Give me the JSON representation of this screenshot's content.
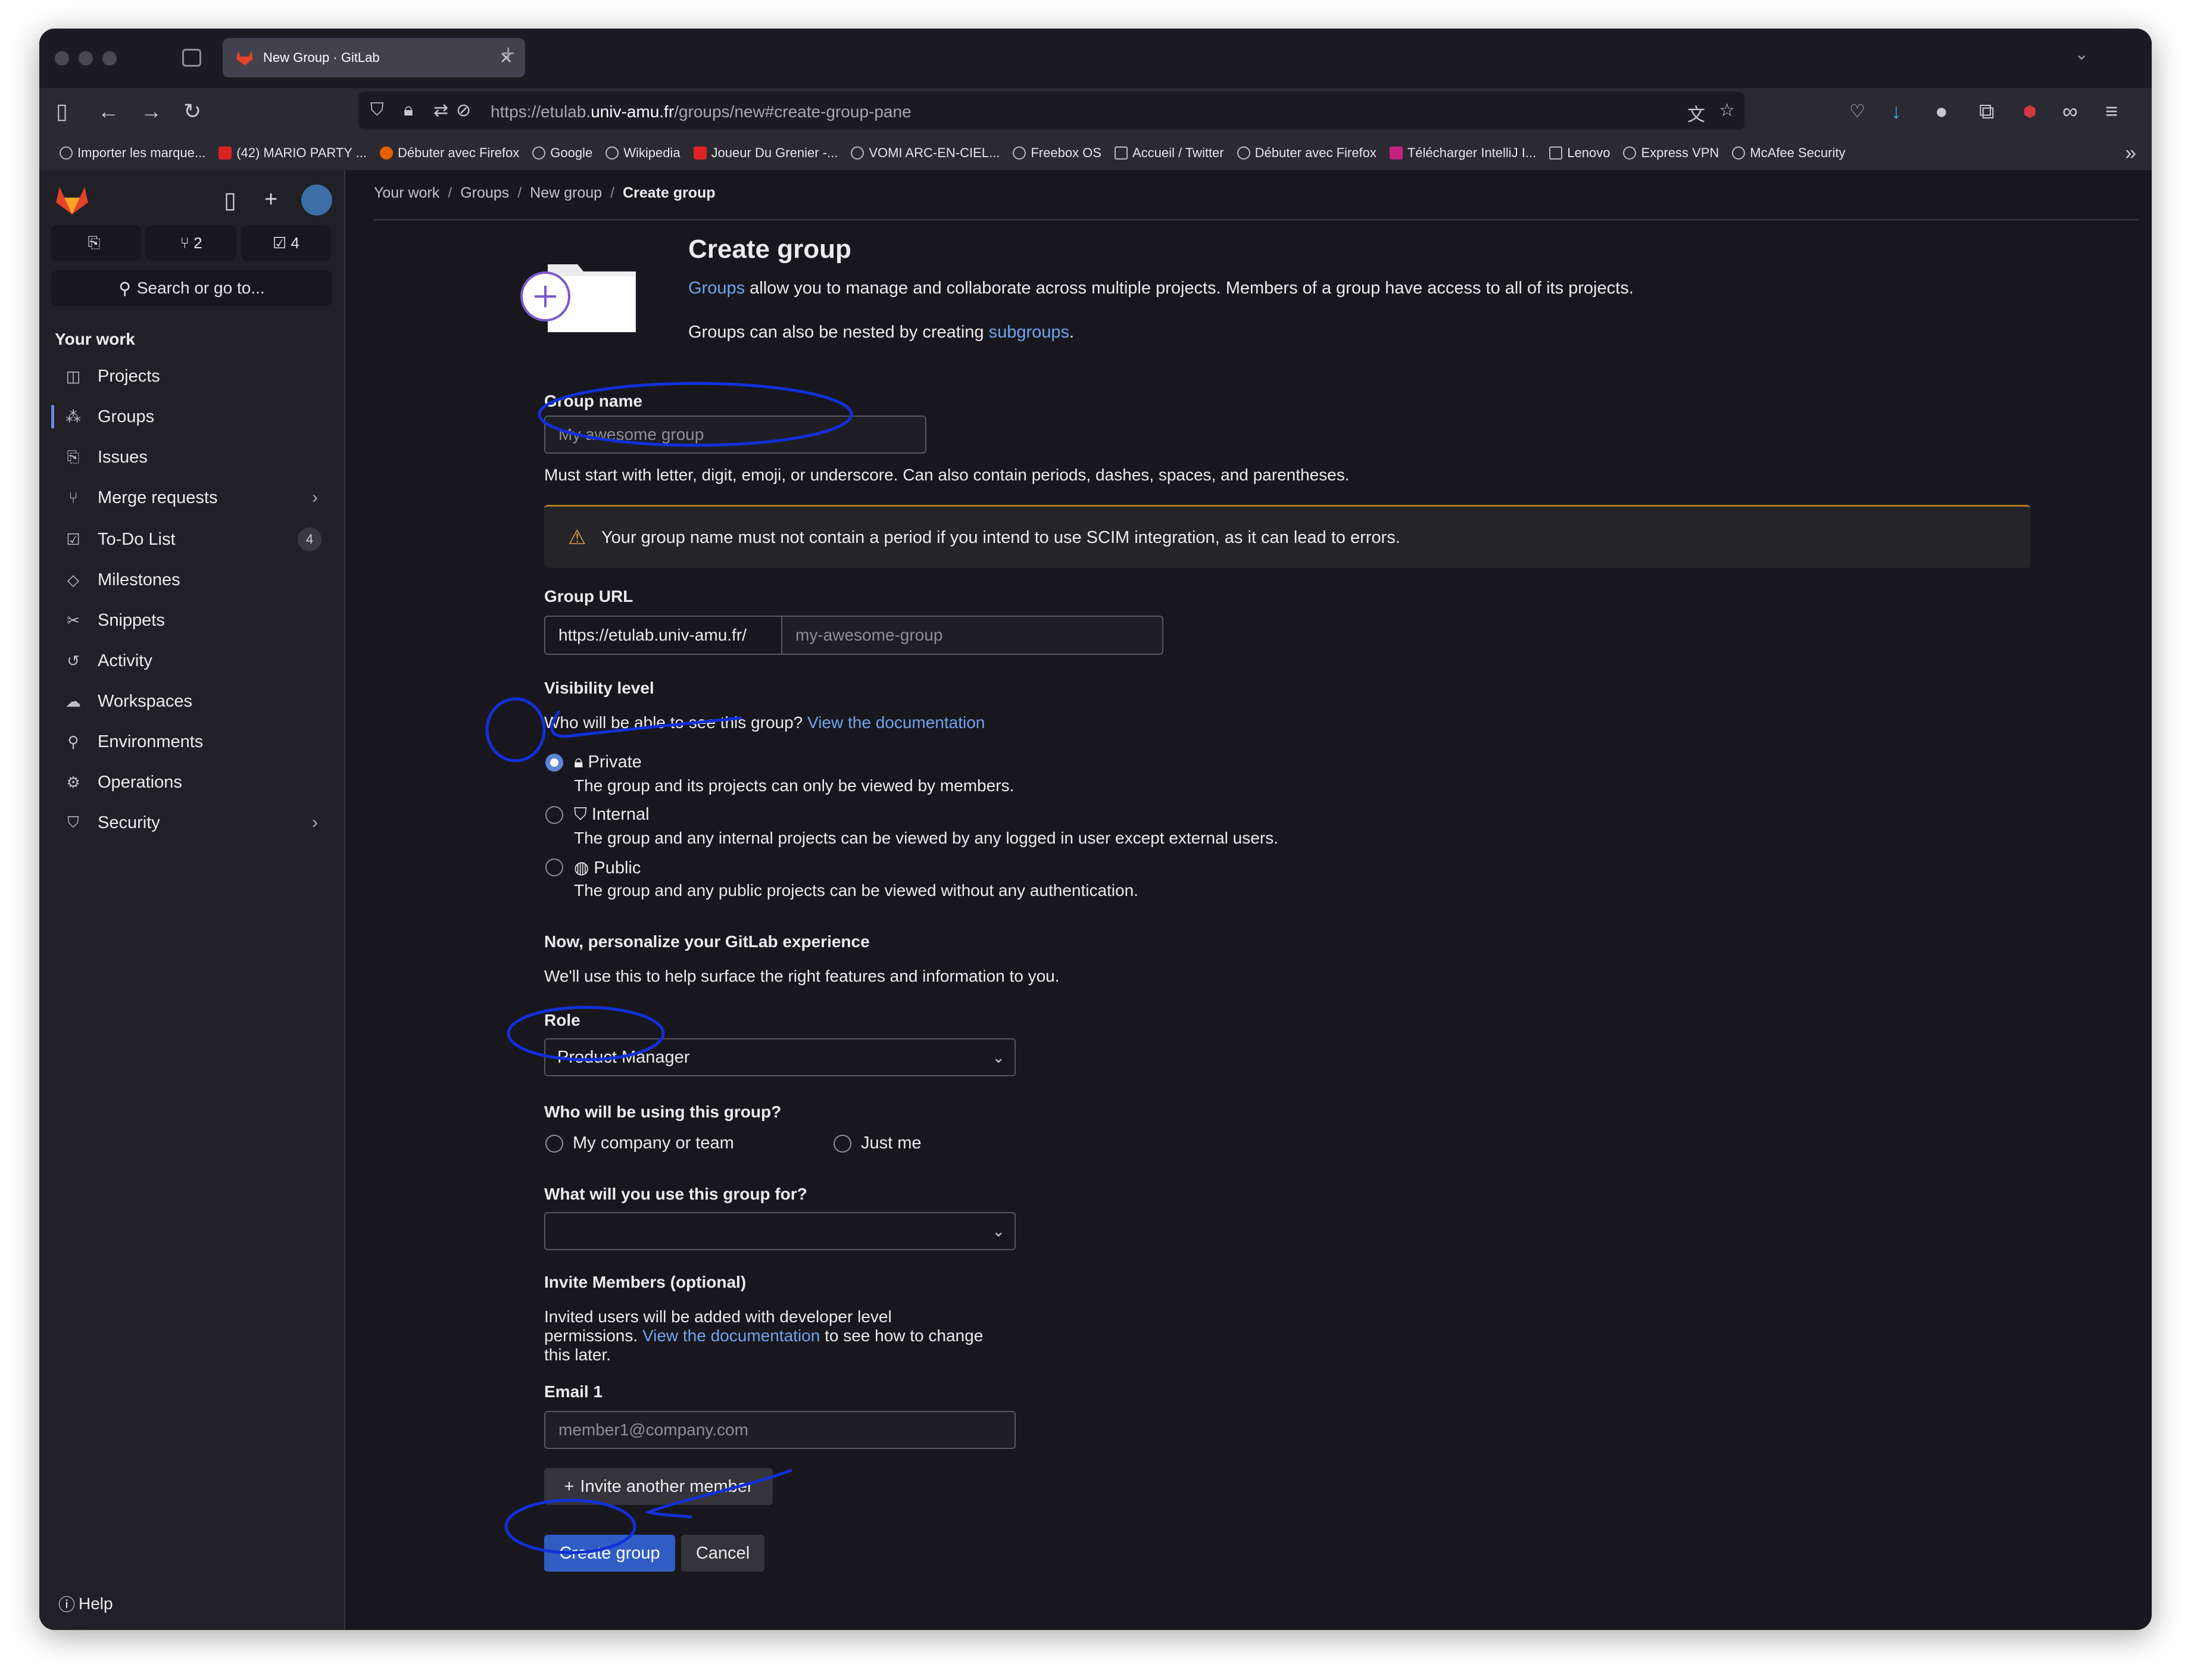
{
  "browser": {
    "tab_title": "New Group · GitLab",
    "url_prefix": "https://etulab.",
    "url_domain": "univ-amu.fr",
    "url_path": "/groups/new#create-group-pane",
    "bookmarks": [
      "Importer les marque...",
      "(42) MARIO PARTY ...",
      "Débuter avec Firefox",
      "Google",
      "Wikipedia",
      "Joueur Du Grenier -...",
      "VOMI ARC-EN-CIEL...",
      "Freebox OS",
      "Accueil / Twitter",
      "Débuter avec Firefox",
      "Télécharger IntelliJ I...",
      "Lenovo",
      "Express VPN",
      "McAfee Security"
    ]
  },
  "sidebar": {
    "counters": {
      "issues": "",
      "merge_requests": "2",
      "todos": "4"
    },
    "search_label": "Search or go to...",
    "section_title": "Your work",
    "items": [
      {
        "label": "Projects",
        "icon": "project-icon"
      },
      {
        "label": "Groups",
        "icon": "group-icon"
      },
      {
        "label": "Issues",
        "icon": "issues-icon"
      },
      {
        "label": "Merge requests",
        "icon": "merge-request-icon"
      },
      {
        "label": "To-Do List",
        "icon": "todo-icon",
        "badge": "4"
      },
      {
        "label": "Milestones",
        "icon": "milestone-icon"
      },
      {
        "label": "Snippets",
        "icon": "snippet-icon"
      },
      {
        "label": "Activity",
        "icon": "history-icon"
      },
      {
        "label": "Workspaces",
        "icon": "cloud-icon"
      },
      {
        "label": "Environments",
        "icon": "environment-icon"
      },
      {
        "label": "Operations",
        "icon": "deployments-icon"
      },
      {
        "label": "Security",
        "icon": "shield-icon"
      }
    ],
    "help_label": "Help"
  },
  "breadcrumbs": [
    "Your work",
    "Groups",
    "New group",
    "Create group"
  ],
  "page": {
    "title": "Create group",
    "intro_link": "Groups",
    "intro_rest": " allow you to manage and collaborate across multiple projects. Members of a group have access to all of its projects.",
    "nested_text": "Groups can also be nested by creating ",
    "nested_link": "subgroups",
    "nested_end": "."
  },
  "form": {
    "group_name_label": "Group name",
    "group_name_placeholder": "My awesome group",
    "group_name_help": "Must start with letter, digit, emoji, or underscore. Can also contain periods, dashes, spaces, and parentheses.",
    "alert_text": "Your group name must not contain a period if you intend to use SCIM integration, as it can lead to errors.",
    "group_url_label": "Group URL",
    "group_url_prefix": "https://etulab.univ-amu.fr/",
    "group_url_placeholder": "my-awesome-group",
    "visibility_label": "Visibility level",
    "visibility_question": "Who will be able to see this group? ",
    "visibility_doc_link": "View the documentation",
    "visibility_options": [
      {
        "label": "Private",
        "help": "The group and its projects can only be viewed by members.",
        "checked": true
      },
      {
        "label": "Internal",
        "help": "The group and any internal projects can be viewed by any logged in user except external users.",
        "checked": false
      },
      {
        "label": "Public",
        "help": "The group and any public projects can be viewed without any authentication.",
        "checked": false
      }
    ],
    "personalize_title": "Now, personalize your GitLab experience",
    "personalize_text": "We'll use this to help surface the right features and information to you.",
    "role_label": "Role",
    "role_value": "Product Manager",
    "using_label": "Who will be using this group?",
    "using_options": [
      "My company or team",
      "Just me"
    ],
    "purpose_label": "What will you use this group for?",
    "purpose_value": "",
    "invite_title": "Invite Members (optional)",
    "invite_text_1": "Invited users will be added with developer level",
    "invite_text_2a": "permissions. ",
    "invite_doc_link": "View the documentation",
    "invite_text_2b": " to see how to change",
    "invite_text_3": "this later.",
    "email_label": "Email 1",
    "email_placeholder": "member1@company.com",
    "invite_another": "Invite another member",
    "create_button": "Create group",
    "cancel_button": "Cancel"
  },
  "colors": {
    "accent": "#2f5dc4",
    "link": "#6ea4f0",
    "annotation": "#1230d8",
    "warning": "#e0a443"
  }
}
